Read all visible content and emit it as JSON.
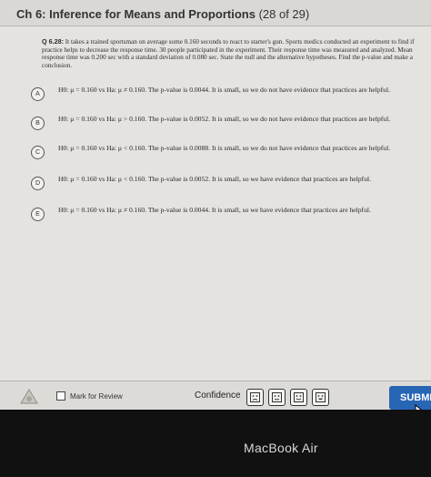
{
  "header": {
    "chapter": "Ch 6: Inference for Means and Proportions",
    "progress": "(28 of 29)"
  },
  "question": {
    "number": "Q 6.28:",
    "text": "It takes a trained sportsman on average some 0.160 seconds to react to starter's gun. Sports medics conducted an experiment to find if practice helps to decrease the response time. 30 people participated in the experiment. Their response time was measured and analyzed. Mean response time was 0.200 sec with a standard deviation of 0.080 sec. State the null and the alternative hypotheses. Find the p-value and make a conclusion."
  },
  "options": [
    {
      "letter": "A",
      "text": "H0: μ = 0.160 vs Ha: μ ≠ 0.160. The p-value is 0.0044. It is small, so we do not have evidence that practices are helpful."
    },
    {
      "letter": "B",
      "text": "H0: μ = 0.160 vs Ha: μ > 0.160. The p-value is 0.0052. It is small, so we do not have evidence that practices are helpful."
    },
    {
      "letter": "C",
      "text": "H0: μ = 0.160 vs Ha: μ < 0.160. The p-value is 0.0088. It is small, so we do not have evidence that practices are helpful."
    },
    {
      "letter": "D",
      "text": "H0: μ = 0.160 vs Ha: μ < 0.160. The p-value is 0.0052. It is small, so we have evidence that practices are helpful."
    },
    {
      "letter": "E",
      "text": "H0: μ = 0.160 vs Ha: μ ≠ 0.160. The p-value is 0.0044. It is small, so we have evidence that practices are helpful."
    }
  ],
  "footer": {
    "mark_for_review": "Mark for Review",
    "confidence_label": "Confidence",
    "confidence_icons": [
      "sad-face-icon",
      "neutral-face-icon",
      "slight-smile-face-icon",
      "happy-face-icon"
    ],
    "submit_label": "SUBMI"
  },
  "device": {
    "brand": "MacBook Air"
  },
  "colors": {
    "submit": "#2766b5",
    "screen_bg": "#e4e3e0"
  }
}
